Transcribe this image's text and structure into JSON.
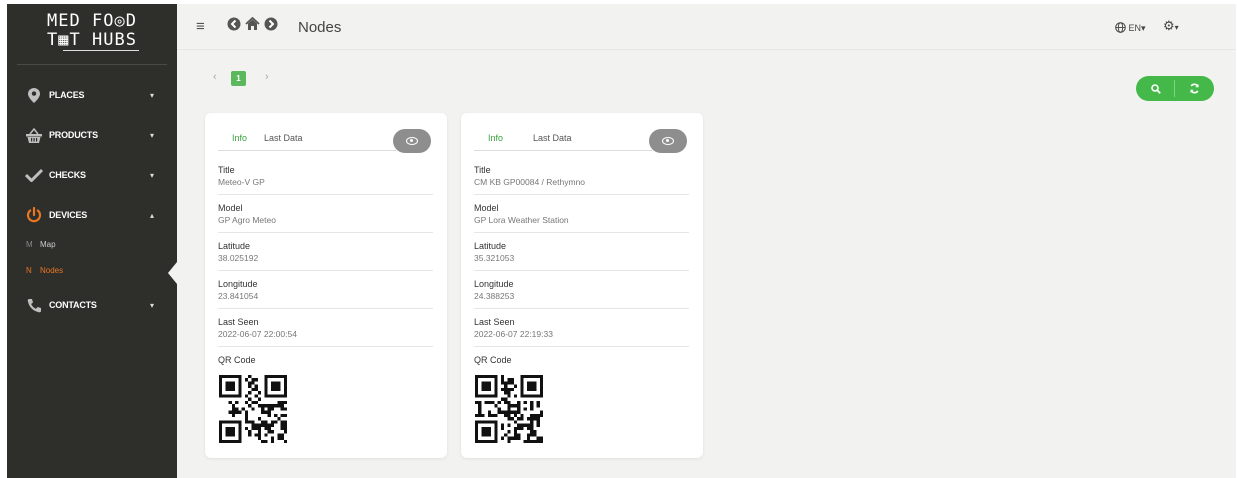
{
  "sidebar": {
    "logo_line1": "MED FO◎D",
    "logo_line2": "T▦T HUBS",
    "items": [
      {
        "label": "PLACES",
        "icon": "map-marker-icon"
      },
      {
        "label": "PRODUCTS",
        "icon": "basket-icon"
      },
      {
        "label": "CHECKS",
        "icon": "check-icon"
      },
      {
        "label": "DEVICES",
        "icon": "power-icon"
      },
      {
        "label": "CONTACTS",
        "icon": "phone-icon"
      }
    ],
    "subitems": [
      {
        "letter": "M",
        "label": "Map"
      },
      {
        "letter": "N",
        "label": "Nodes"
      }
    ]
  },
  "header": {
    "title": "Nodes",
    "language": "EN"
  },
  "pagination": {
    "current_page": "1"
  },
  "colors": {
    "accent_green": "#44b94a",
    "active_orange": "#e87722",
    "sidebar_bg": "#2e2e2a"
  },
  "cards": [
    {
      "tab_info": "Info",
      "tab_last_data": "Last Data",
      "fields": [
        {
          "label": "Title",
          "value": "Meteo-V GP"
        },
        {
          "label": "Model",
          "value": "GP Agro Meteo"
        },
        {
          "label": "Latitude",
          "value": "38.025192"
        },
        {
          "label": "Longitude",
          "value": "23.841054"
        },
        {
          "label": "Last Seen",
          "value": "2022-06-07 22:00:54"
        }
      ],
      "qr_label": "QR Code"
    },
    {
      "tab_info": "Info",
      "tab_last_data": "Last Data",
      "fields": [
        {
          "label": "Title",
          "value": "CM KB GP00084 / Rethymno"
        },
        {
          "label": "Model",
          "value": "GP Lora Weather Station"
        },
        {
          "label": "Latitude",
          "value": "35.321053"
        },
        {
          "label": "Longitude",
          "value": "24.388253"
        },
        {
          "label": "Last Seen",
          "value": "2022-06-07 22:19:33"
        }
      ],
      "qr_label": "QR Code"
    }
  ]
}
